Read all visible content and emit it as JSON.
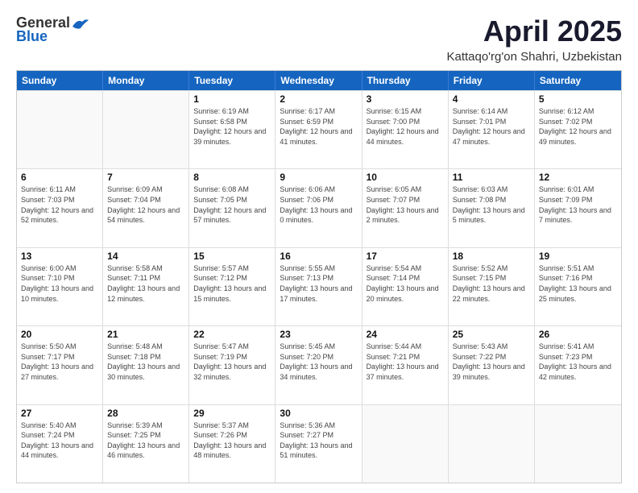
{
  "logo": {
    "general": "General",
    "blue": "Blue"
  },
  "title": "April 2025",
  "subtitle": "Kattaqo'rg'on Shahri, Uzbekistan",
  "headers": [
    "Sunday",
    "Monday",
    "Tuesday",
    "Wednesday",
    "Thursday",
    "Friday",
    "Saturday"
  ],
  "weeks": [
    [
      {
        "day": "",
        "sunrise": "",
        "sunset": "",
        "daylight": "",
        "empty": true
      },
      {
        "day": "",
        "sunrise": "",
        "sunset": "",
        "daylight": "",
        "empty": true
      },
      {
        "day": "1",
        "sunrise": "Sunrise: 6:19 AM",
        "sunset": "Sunset: 6:58 PM",
        "daylight": "Daylight: 12 hours and 39 minutes."
      },
      {
        "day": "2",
        "sunrise": "Sunrise: 6:17 AM",
        "sunset": "Sunset: 6:59 PM",
        "daylight": "Daylight: 12 hours and 41 minutes."
      },
      {
        "day": "3",
        "sunrise": "Sunrise: 6:15 AM",
        "sunset": "Sunset: 7:00 PM",
        "daylight": "Daylight: 12 hours and 44 minutes."
      },
      {
        "day": "4",
        "sunrise": "Sunrise: 6:14 AM",
        "sunset": "Sunset: 7:01 PM",
        "daylight": "Daylight: 12 hours and 47 minutes."
      },
      {
        "day": "5",
        "sunrise": "Sunrise: 6:12 AM",
        "sunset": "Sunset: 7:02 PM",
        "daylight": "Daylight: 12 hours and 49 minutes."
      }
    ],
    [
      {
        "day": "6",
        "sunrise": "Sunrise: 6:11 AM",
        "sunset": "Sunset: 7:03 PM",
        "daylight": "Daylight: 12 hours and 52 minutes."
      },
      {
        "day": "7",
        "sunrise": "Sunrise: 6:09 AM",
        "sunset": "Sunset: 7:04 PM",
        "daylight": "Daylight: 12 hours and 54 minutes."
      },
      {
        "day": "8",
        "sunrise": "Sunrise: 6:08 AM",
        "sunset": "Sunset: 7:05 PM",
        "daylight": "Daylight: 12 hours and 57 minutes."
      },
      {
        "day": "9",
        "sunrise": "Sunrise: 6:06 AM",
        "sunset": "Sunset: 7:06 PM",
        "daylight": "Daylight: 13 hours and 0 minutes."
      },
      {
        "day": "10",
        "sunrise": "Sunrise: 6:05 AM",
        "sunset": "Sunset: 7:07 PM",
        "daylight": "Daylight: 13 hours and 2 minutes."
      },
      {
        "day": "11",
        "sunrise": "Sunrise: 6:03 AM",
        "sunset": "Sunset: 7:08 PM",
        "daylight": "Daylight: 13 hours and 5 minutes."
      },
      {
        "day": "12",
        "sunrise": "Sunrise: 6:01 AM",
        "sunset": "Sunset: 7:09 PM",
        "daylight": "Daylight: 13 hours and 7 minutes."
      }
    ],
    [
      {
        "day": "13",
        "sunrise": "Sunrise: 6:00 AM",
        "sunset": "Sunset: 7:10 PM",
        "daylight": "Daylight: 13 hours and 10 minutes."
      },
      {
        "day": "14",
        "sunrise": "Sunrise: 5:58 AM",
        "sunset": "Sunset: 7:11 PM",
        "daylight": "Daylight: 13 hours and 12 minutes."
      },
      {
        "day": "15",
        "sunrise": "Sunrise: 5:57 AM",
        "sunset": "Sunset: 7:12 PM",
        "daylight": "Daylight: 13 hours and 15 minutes."
      },
      {
        "day": "16",
        "sunrise": "Sunrise: 5:55 AM",
        "sunset": "Sunset: 7:13 PM",
        "daylight": "Daylight: 13 hours and 17 minutes."
      },
      {
        "day": "17",
        "sunrise": "Sunrise: 5:54 AM",
        "sunset": "Sunset: 7:14 PM",
        "daylight": "Daylight: 13 hours and 20 minutes."
      },
      {
        "day": "18",
        "sunrise": "Sunrise: 5:52 AM",
        "sunset": "Sunset: 7:15 PM",
        "daylight": "Daylight: 13 hours and 22 minutes."
      },
      {
        "day": "19",
        "sunrise": "Sunrise: 5:51 AM",
        "sunset": "Sunset: 7:16 PM",
        "daylight": "Daylight: 13 hours and 25 minutes."
      }
    ],
    [
      {
        "day": "20",
        "sunrise": "Sunrise: 5:50 AM",
        "sunset": "Sunset: 7:17 PM",
        "daylight": "Daylight: 13 hours and 27 minutes."
      },
      {
        "day": "21",
        "sunrise": "Sunrise: 5:48 AM",
        "sunset": "Sunset: 7:18 PM",
        "daylight": "Daylight: 13 hours and 30 minutes."
      },
      {
        "day": "22",
        "sunrise": "Sunrise: 5:47 AM",
        "sunset": "Sunset: 7:19 PM",
        "daylight": "Daylight: 13 hours and 32 minutes."
      },
      {
        "day": "23",
        "sunrise": "Sunrise: 5:45 AM",
        "sunset": "Sunset: 7:20 PM",
        "daylight": "Daylight: 13 hours and 34 minutes."
      },
      {
        "day": "24",
        "sunrise": "Sunrise: 5:44 AM",
        "sunset": "Sunset: 7:21 PM",
        "daylight": "Daylight: 13 hours and 37 minutes."
      },
      {
        "day": "25",
        "sunrise": "Sunrise: 5:43 AM",
        "sunset": "Sunset: 7:22 PM",
        "daylight": "Daylight: 13 hours and 39 minutes."
      },
      {
        "day": "26",
        "sunrise": "Sunrise: 5:41 AM",
        "sunset": "Sunset: 7:23 PM",
        "daylight": "Daylight: 13 hours and 42 minutes."
      }
    ],
    [
      {
        "day": "27",
        "sunrise": "Sunrise: 5:40 AM",
        "sunset": "Sunset: 7:24 PM",
        "daylight": "Daylight: 13 hours and 44 minutes."
      },
      {
        "day": "28",
        "sunrise": "Sunrise: 5:39 AM",
        "sunset": "Sunset: 7:25 PM",
        "daylight": "Daylight: 13 hours and 46 minutes."
      },
      {
        "day": "29",
        "sunrise": "Sunrise: 5:37 AM",
        "sunset": "Sunset: 7:26 PM",
        "daylight": "Daylight: 13 hours and 48 minutes."
      },
      {
        "day": "30",
        "sunrise": "Sunrise: 5:36 AM",
        "sunset": "Sunset: 7:27 PM",
        "daylight": "Daylight: 13 hours and 51 minutes."
      },
      {
        "day": "",
        "sunrise": "",
        "sunset": "",
        "daylight": "",
        "empty": true
      },
      {
        "day": "",
        "sunrise": "",
        "sunset": "",
        "daylight": "",
        "empty": true
      },
      {
        "day": "",
        "sunrise": "",
        "sunset": "",
        "daylight": "",
        "empty": true
      }
    ]
  ]
}
